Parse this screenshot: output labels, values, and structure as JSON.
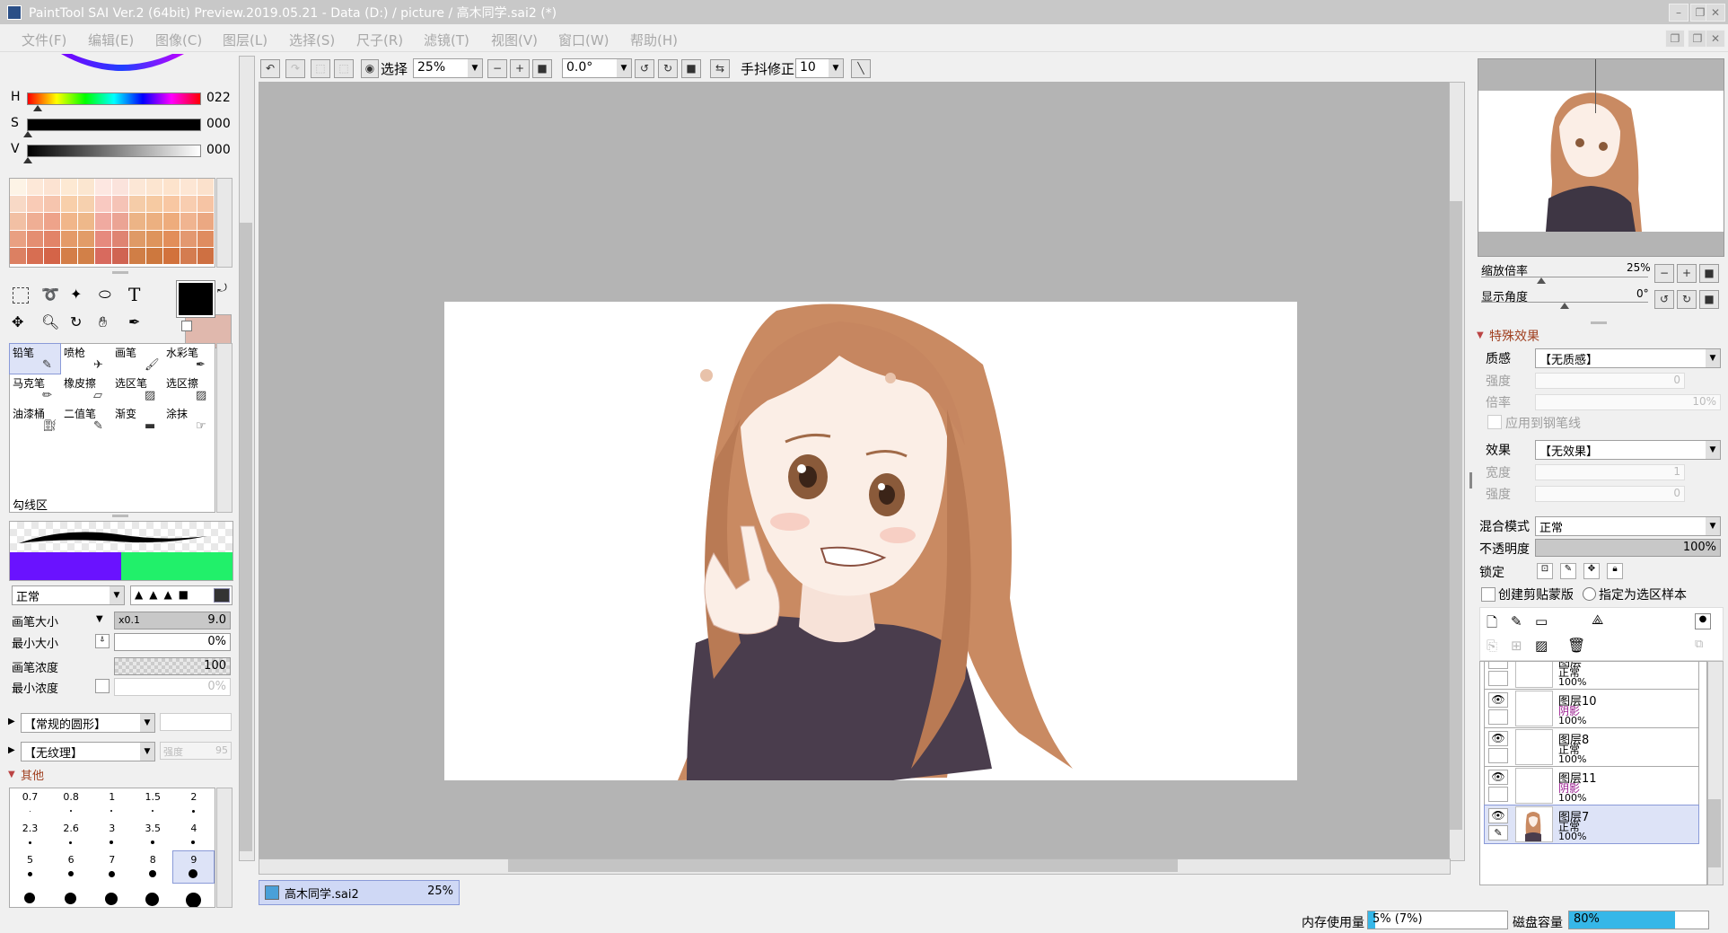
{
  "window": {
    "title": "PaintTool SAI Ver.2 (64bit) Preview.2019.05.21 - Data (D:) / picture / 高木同学.sai2 (*)"
  },
  "menu": [
    "文件(F)",
    "编辑(E)",
    "图像(C)",
    "图层(L)",
    "选择(S)",
    "尺子(R)",
    "滤镜(T)",
    "视图(V)",
    "窗口(W)",
    "帮助(H)"
  ],
  "hsv": {
    "h_label": "H",
    "h_value": "022",
    "s_label": "S",
    "s_value": "000",
    "v_label": "V",
    "v_value": "000"
  },
  "tools": [
    {
      "label": "铅笔",
      "icon": "pencil-icon"
    },
    {
      "label": "喷枪",
      "icon": "airbrush-icon"
    },
    {
      "label": "画笔",
      "icon": "brush-icon"
    },
    {
      "label": "水彩笔",
      "icon": "watercolor-icon"
    },
    {
      "label": "马克笔",
      "icon": "marker-icon"
    },
    {
      "label": "橡皮擦",
      "icon": "eraser-icon"
    },
    {
      "label": "选区笔",
      "icon": "selpen-icon"
    },
    {
      "label": "选区擦",
      "icon": "selerase-icon"
    },
    {
      "label": "油漆桶",
      "icon": "bucket-icon"
    },
    {
      "label": "二值笔",
      "icon": "binary-pen-icon"
    },
    {
      "label": "渐变",
      "icon": "gradient-icon"
    },
    {
      "label": "涂抹",
      "icon": "smudge-icon"
    }
  ],
  "tool_footer": "勾线区",
  "brush": {
    "mode": "正常",
    "size_label": "画笔大小",
    "size_mult": "x0.1",
    "size_value": "9.0",
    "min_size_label": "最小大小",
    "min_size_value": "0%",
    "density_label": "画笔浓度",
    "density_value": "100",
    "min_density_label": "最小浓度",
    "min_density_value": "0%",
    "shape": "【常规的圆形】",
    "texture": "【无纹理】",
    "texture_strength_label": "强度",
    "texture_strength_value": "95",
    "other_label": "其他",
    "sizes": [
      "0.7",
      "0.8",
      "1",
      "1.5",
      "2",
      "2.3",
      "2.6",
      "3",
      "3.5",
      "4",
      "5",
      "6",
      "7",
      "8",
      "9"
    ]
  },
  "toolbar": {
    "select_label": "选择",
    "zoom": "25%",
    "angle": "0.0°",
    "stabilizer_label": "手抖修正",
    "stabilizer_value": "10"
  },
  "document_tab": {
    "name": "高木同学.sai2",
    "zoom": "25%"
  },
  "navigator": {
    "zoom_label": "缩放倍率",
    "zoom_value": "25%",
    "angle_label": "显示角度",
    "angle_value": "0°"
  },
  "effects": {
    "section": "特殊效果",
    "texture_label": "质感",
    "texture_value": "【无质感】",
    "strength_label": "强度",
    "strength_value": "0",
    "scale_label": "倍率",
    "scale_value": "10%",
    "apply_label": "应用到钢笔线",
    "effect_label": "效果",
    "effect_value": "【无效果】",
    "width_label": "宽度",
    "width_value": "1",
    "strength2_label": "强度",
    "strength2_value": "0"
  },
  "layer_props": {
    "blend_label": "混合模式",
    "blend_value": "正常",
    "opacity_label": "不透明度",
    "opacity_value": "100%",
    "lock_label": "锁定",
    "clip_label": "创建剪贴蒙版",
    "selsrc_label": "指定为选区样本"
  },
  "layers": [
    {
      "name": "图层",
      "mode": "正常",
      "opacity": "100%",
      "mode_color": "#000000"
    },
    {
      "name": "图层10",
      "mode": "阴影",
      "opacity": "100%",
      "mode_color": "#9a1b8f"
    },
    {
      "name": "图层8",
      "mode": "正常",
      "opacity": "100%",
      "mode_color": "#000000"
    },
    {
      "name": "图层11",
      "mode": "阴影",
      "opacity": "100%",
      "mode_color": "#9a1b8f"
    },
    {
      "name": "图层7",
      "mode": "正常",
      "opacity": "100%",
      "mode_color": "#000000"
    }
  ],
  "status": {
    "memory_label": "内存使用量",
    "memory_value": "5% (7%)",
    "memory_fraction": 0.05,
    "disk_label": "磁盘容量",
    "disk_value": "80%",
    "disk_fraction": 0.8
  }
}
